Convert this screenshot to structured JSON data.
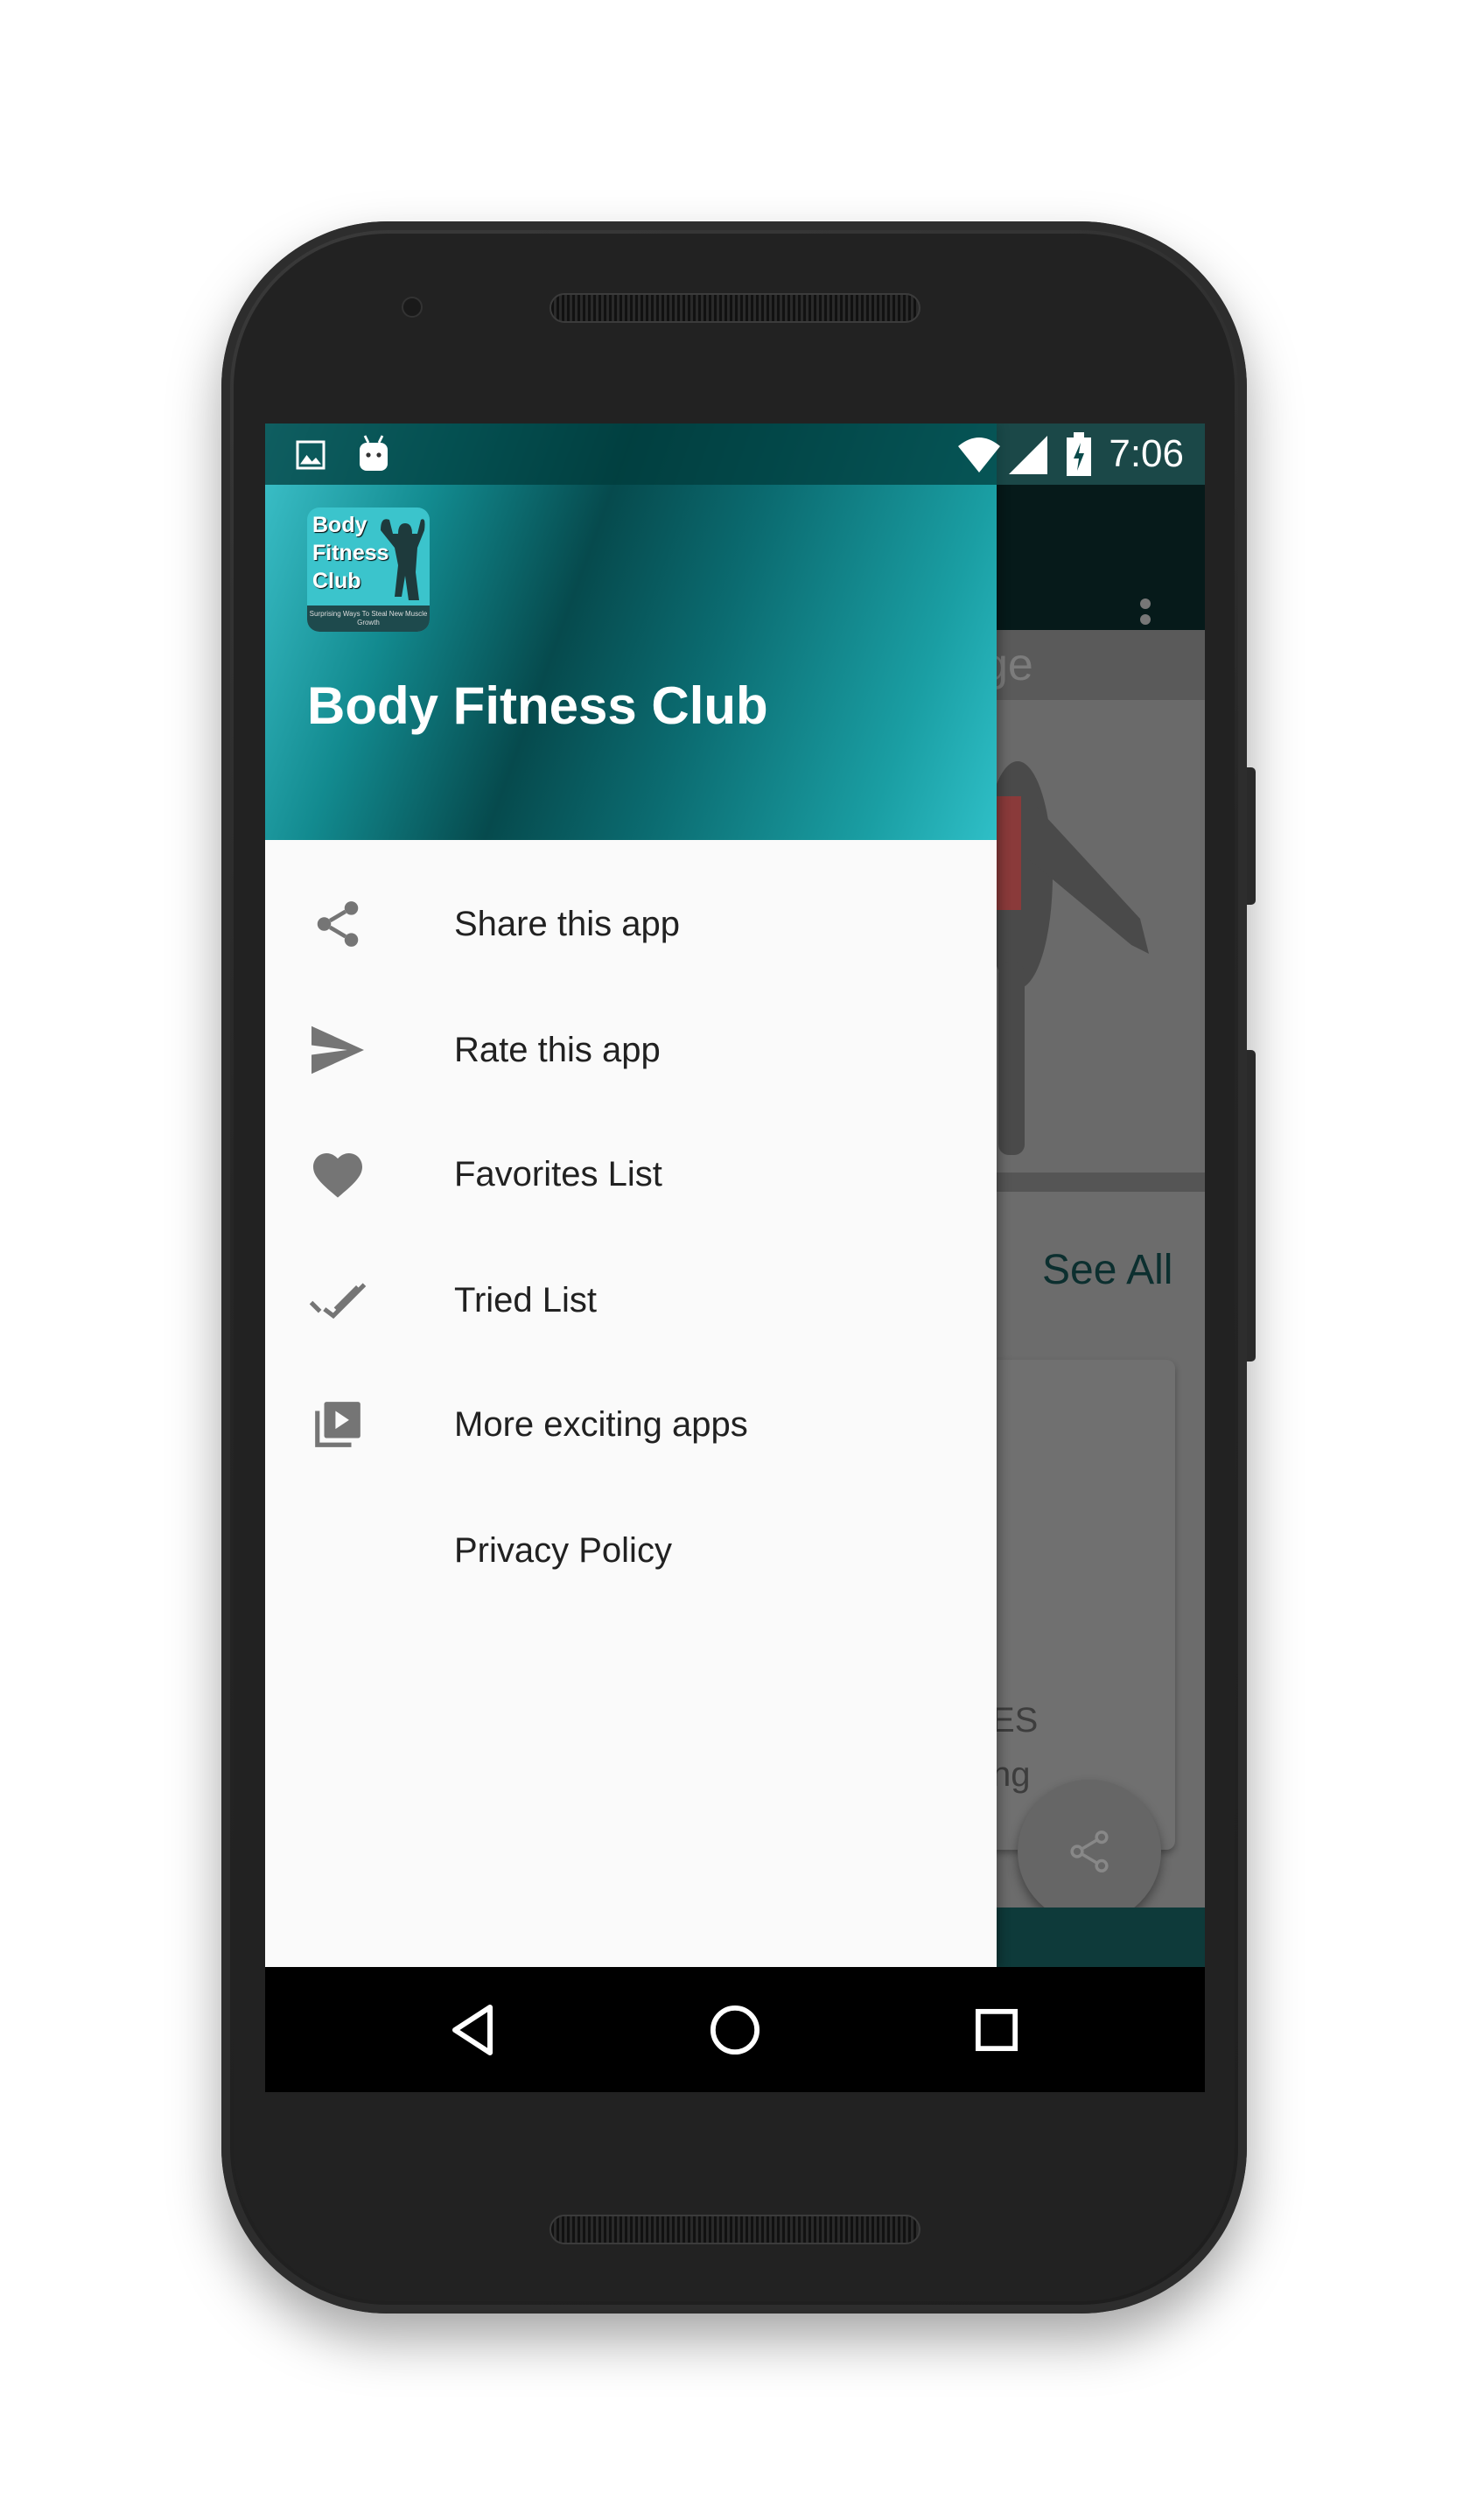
{
  "status_bar": {
    "time": "7:06",
    "icons": [
      "image-icon",
      "android-icon",
      "wifi-icon",
      "signal-icon",
      "battery-charging-icon"
    ]
  },
  "drawer": {
    "app_title": "Body Fitness Club",
    "logo": {
      "line1": "Body",
      "line2": "Fitness",
      "line3": "Club",
      "tagline": "Surprising Ways To Steal New Muscle Growth"
    },
    "items": [
      {
        "label": "Share this app",
        "icon": "share-icon"
      },
      {
        "label": "Rate this app",
        "icon": "send-icon"
      },
      {
        "label": "Favorites List",
        "icon": "heart-icon"
      },
      {
        "label": "Tried List",
        "icon": "double-check-icon"
      },
      {
        "label": "More exciting apps",
        "icon": "video-library-icon"
      },
      {
        "label": "Privacy Policy",
        "icon": ""
      }
    ]
  },
  "background": {
    "band_text": "ge",
    "see_all": "See All",
    "card_line1": "ES",
    "card_line2": "ng"
  },
  "navigation_bar": {
    "buttons": [
      "back",
      "home",
      "recents"
    ]
  },
  "colors": {
    "accent": "#1a9ea3",
    "drawer_bg": "#fafafa",
    "icon": "#757575"
  }
}
